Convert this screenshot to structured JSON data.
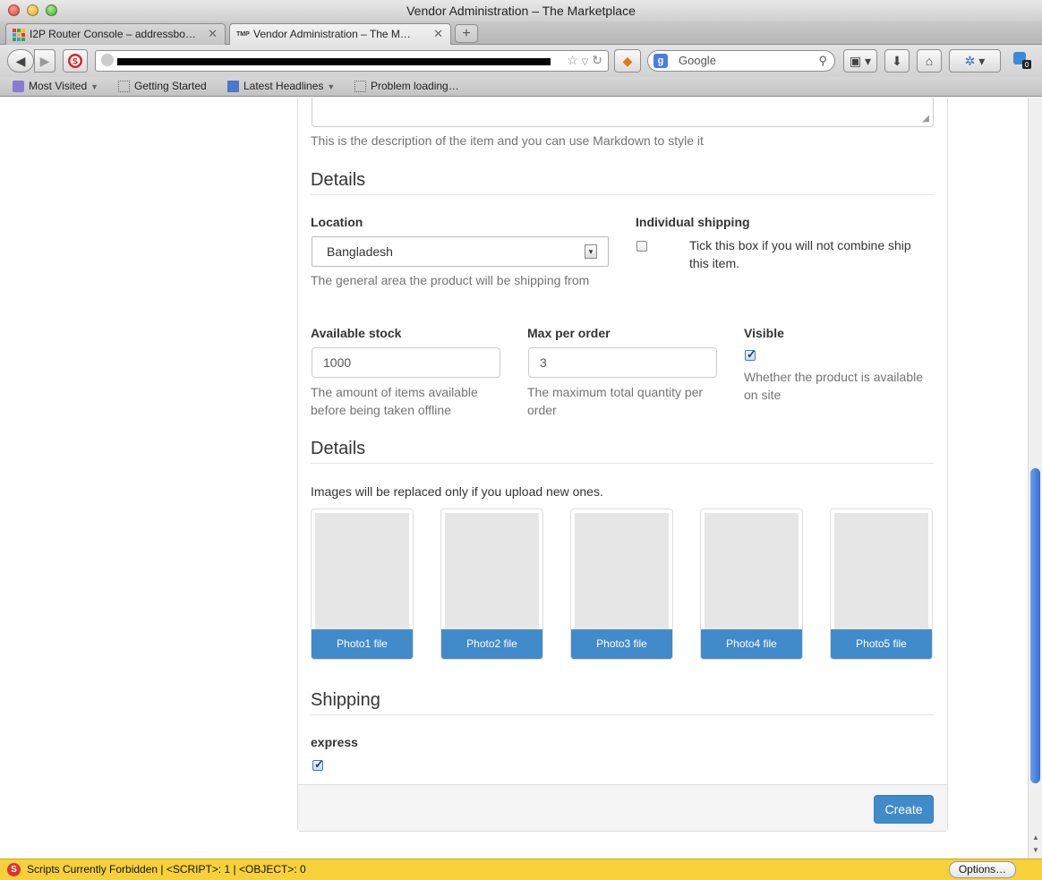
{
  "window": {
    "title": "Vendor Administration – The Marketplace"
  },
  "tabs": [
    {
      "label": "I2P Router Console – addressbo…"
    },
    {
      "label": "Vendor Administration – The M…"
    }
  ],
  "navbar": {
    "search_placeholder": "Google"
  },
  "bookmarks": [
    {
      "label": "Most Visited"
    },
    {
      "label": "Getting Started"
    },
    {
      "label": "Latest Headlines"
    },
    {
      "label": "Problem loading…"
    }
  ],
  "form": {
    "description_help": "This is the description of the item and you can use Markdown to style it",
    "details_title": "Details",
    "location": {
      "label": "Location",
      "value": "Bangladesh",
      "help": "The general area the product will be shipping from"
    },
    "individual_shipping": {
      "label": "Individual shipping",
      "help": "Tick this box if you will not combine ship this item.",
      "checked": false
    },
    "stock": {
      "label": "Available stock",
      "value": "1000",
      "help": "The amount of items available before being taken offline"
    },
    "max_per_order": {
      "label": "Max per order",
      "value": "3",
      "help": "The maximum total quantity per order"
    },
    "visible": {
      "label": "Visible",
      "help": "Whether the product is available on site",
      "checked": true
    },
    "images_title": "Details",
    "images_help": "Images will be replaced only if you upload new ones.",
    "photos": [
      {
        "label": "Photo1 file"
      },
      {
        "label": "Photo2 file"
      },
      {
        "label": "Photo3 file"
      },
      {
        "label": "Photo4 file"
      },
      {
        "label": "Photo5 file"
      }
    ],
    "shipping_title": "Shipping",
    "express": {
      "label": "express",
      "checked": true
    },
    "create_label": "Create"
  },
  "statusbar": {
    "text": "Scripts Currently Forbidden | <SCRIPT>: 1 | <OBJECT>: 0",
    "options_label": "Options…"
  },
  "colors": {
    "primary": "#428bca",
    "statusbar": "#f7d13a"
  }
}
